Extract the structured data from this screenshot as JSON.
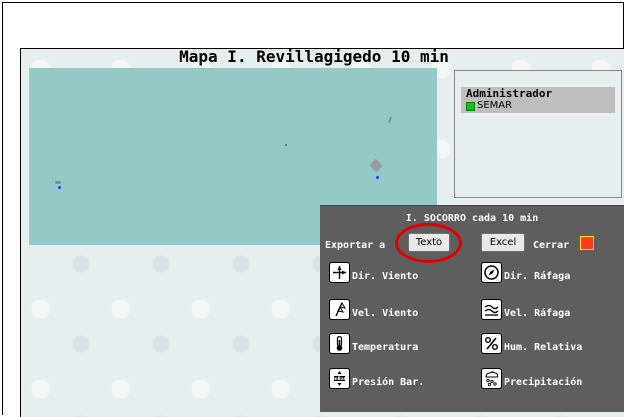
{
  "title": "Mapa I. Revillagigedo 10 min",
  "legend": {
    "title": "Administrador",
    "items": [
      {
        "label": "SEMAR",
        "checked": true,
        "color": "#18c018"
      }
    ]
  },
  "panel": {
    "title": "I. SOCORRO cada 10 min",
    "export_label": "Exportar a",
    "texto_label": "Texto",
    "excel_label": "Excel",
    "close_label": "Cerrar",
    "items": [
      {
        "label": "Dir. Viento",
        "icon": "wind-direction-icon"
      },
      {
        "label": "Dir. Ráfaga",
        "icon": "compass-icon"
      },
      {
        "label": "Vel. Viento",
        "icon": "wind-speed-icon"
      },
      {
        "label": "Vel. Ráfaga",
        "icon": "gust-speed-icon"
      },
      {
        "label": "Temperatura",
        "icon": "thermometer-icon"
      },
      {
        "label": "Hum. Relativa",
        "icon": "percent-icon"
      },
      {
        "label": "Presión Bar.",
        "icon": "barometer-icon"
      },
      {
        "label": "Precipitación",
        "icon": "rain-icon"
      }
    ]
  },
  "colors": {
    "map": "#93cac7",
    "panel": "#5e5e5e",
    "highlight": "#e00000",
    "station": "#1f3cff"
  }
}
